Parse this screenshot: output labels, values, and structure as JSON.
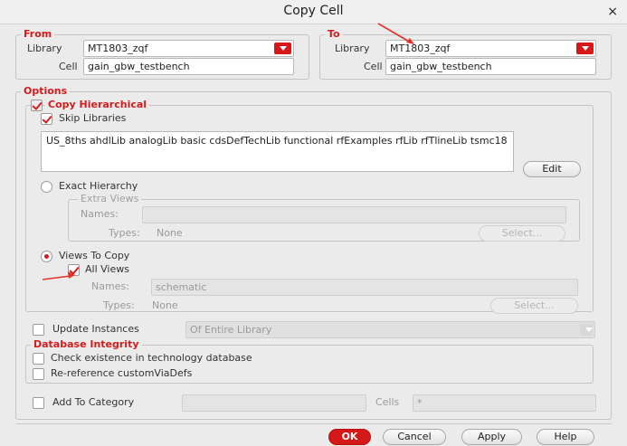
{
  "window": {
    "title": "Copy Cell",
    "close": "×"
  },
  "from": {
    "legend": "From",
    "library_label": "Library",
    "library_value": "MT1803_zqf",
    "cell_label": "Cell",
    "cell_value": "gain_gbw_testbench"
  },
  "to": {
    "legend": "To",
    "library_label": "Library",
    "library_value": "MT1803_zqf",
    "cell_label": "Cell",
    "cell_value": "gain_gbw_testbench"
  },
  "options": {
    "legend": "Options",
    "copy_hierarchical": "Copy Hierarchical",
    "skip_libraries": "Skip Libraries",
    "skip_libraries_text": "US_8ths ahdlLib analogLib basic cdsDefTechLib functional rfExamples rfLib rfTlineLib tsmc18",
    "edit_button": "Edit",
    "exact_hierarchy": "Exact Hierarchy",
    "extra_views_legend": "Extra Views",
    "names_label": "Names:",
    "types_label": "Types:",
    "types_value": "None",
    "select_button": "Select...",
    "views_to_copy": "Views To Copy",
    "all_views": "All Views",
    "views_names_label": "Names:",
    "views_names_value": "schematic",
    "views_types_label": "Types:",
    "views_types_value": "None",
    "views_select_button": "Select...",
    "update_instances": "Update Instances",
    "update_scope": "Of Entire Library",
    "database_integrity_legend": "Database Integrity",
    "check_tech_db": "Check existence in technology database",
    "rereference_vias": "Re-reference customViaDefs",
    "add_to_category": "Add To Category",
    "cells_label": "Cells",
    "cells_value": "*"
  },
  "buttons": {
    "ok": "OK",
    "cancel": "Cancel",
    "apply": "Apply",
    "help": "Help"
  },
  "colors": {
    "accent": "#d41c1c",
    "annotation_arrow": "#e4312b"
  }
}
